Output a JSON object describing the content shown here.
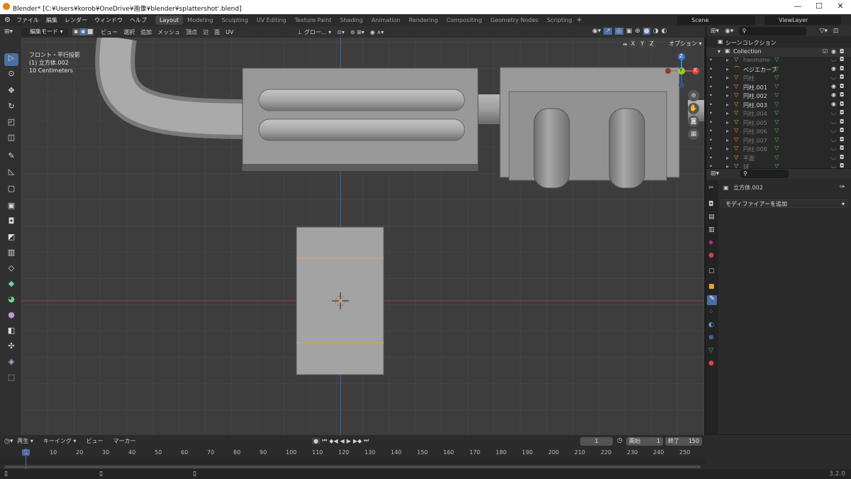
{
  "window": {
    "title": "Blender* [C:¥Users¥korob¥OneDrive¥画像¥blender¥splattershot'.blend]"
  },
  "menu": [
    "ファイル",
    "編集",
    "レンダー",
    "ウィンドウ",
    "ヘルプ"
  ],
  "workspaces": [
    "Layout",
    "Modeling",
    "Sculpting",
    "UV Editing",
    "Texture Paint",
    "Shading",
    "Animation",
    "Rendering",
    "Compositing",
    "Geometry Nodes",
    "Scripting"
  ],
  "scene": {
    "scene_name": "Scene",
    "view_layer": "ViewLayer"
  },
  "viewport_header": {
    "mode": "編集モード",
    "menus": [
      "ビュー",
      "選択",
      "追加",
      "メッシュ",
      "頂点",
      "辺",
      "面",
      "UV"
    ],
    "transform": "グロー...",
    "axes": [
      "X",
      "Y",
      "Z"
    ],
    "options": "オプション"
  },
  "overlay": {
    "view": "フロント・平行投影",
    "object": "(1) 立方体.002",
    "scale": "10 Centimeters"
  },
  "gizmo": {
    "z": "Z",
    "y": "Y",
    "x": "X"
  },
  "outliner": {
    "header": "シーンコレクション",
    "collection": "Collection",
    "items": [
      {
        "name": "hanmono",
        "dim": true
      },
      {
        "name": "ベジエカーブ",
        "dim": false
      },
      {
        "name": "円柱",
        "dim": true
      },
      {
        "name": "円柱.001",
        "dim": false
      },
      {
        "name": "円柱.002",
        "dim": false
      },
      {
        "name": "円柱.003",
        "dim": false
      },
      {
        "name": "円柱.004",
        "dim": true
      },
      {
        "name": "円柱.005",
        "dim": true
      },
      {
        "name": "円柱.006",
        "dim": true
      },
      {
        "name": "円柱.007",
        "dim": true
      },
      {
        "name": "円柱.008",
        "dim": true
      },
      {
        "name": "平面",
        "dim": true
      },
      {
        "name": "球",
        "dim": true
      }
    ]
  },
  "properties": {
    "object": "立方体.002",
    "add_modifier": "モディファイアーを追加"
  },
  "timeline": {
    "menus": [
      "再生",
      "キーイング",
      "ビュー",
      "マーカー"
    ],
    "current_frame": "1",
    "start_label": "開始",
    "start": "1",
    "end_label": "終了",
    "end": "150",
    "ticks": [
      "1",
      "10",
      "20",
      "30",
      "40",
      "50",
      "60",
      "70",
      "80",
      "90",
      "100",
      "110",
      "120",
      "130",
      "140",
      "150",
      "160",
      "170",
      "180",
      "190",
      "200",
      "210",
      "220",
      "230",
      "240",
      "250"
    ]
  },
  "status": {
    "version": "3.2.0"
  },
  "colors": {
    "accent": "#4b6ea3",
    "selected_edge": "#e8a33d",
    "axis_x": "#d94545",
    "axis_y": "#8fcf2f",
    "axis_z": "#3b7ad9"
  }
}
